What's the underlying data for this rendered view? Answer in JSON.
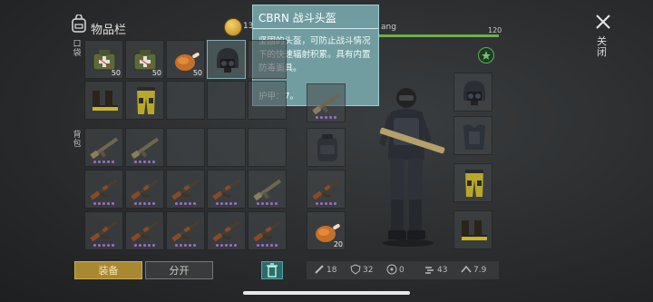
{
  "header": {
    "title": "物品栏",
    "coins": "13",
    "close_label": "关闭"
  },
  "side_labels": {
    "pockets": "口袋",
    "backpack": "背包"
  },
  "tooltip": {
    "title": "CBRN 战斗头盔",
    "description": "坚固的头盔，可防止战斗情况下的快速辐射积累。具有内置防毒面具。",
    "armor": "护甲：7。"
  },
  "character": {
    "name_fragment": "ang",
    "hp": "120",
    "hp_fraction": 1.0
  },
  "pocket_items": [
    {
      "icon": "medkit-icon",
      "count": "50"
    },
    {
      "icon": "medkit-icon",
      "count": "50"
    },
    {
      "icon": "roast-chicken-icon",
      "count": "50"
    },
    {
      "icon": "cbrn-helmet-icon",
      "count": ""
    },
    {
      "icon": "boots-icon",
      "count": ""
    },
    {
      "icon": "pants-icon",
      "count": ""
    }
  ],
  "backpack_items": [
    {
      "icon": "rifle-icon",
      "count": ""
    },
    {
      "icon": "rifle-icon",
      "count": ""
    },
    {
      "icon": "ak-rifle-icon",
      "count": ""
    },
    {
      "icon": "ak-rifle-icon",
      "count": ""
    },
    {
      "icon": "ak-rifle-icon",
      "count": ""
    },
    {
      "icon": "ak-rifle-icon",
      "count": ""
    },
    {
      "icon": "rifle-icon",
      "count": ""
    },
    {
      "icon": "ak-rifle-icon",
      "count": ""
    },
    {
      "icon": "ak-rifle-icon",
      "count": ""
    },
    {
      "icon": "ak-rifle-icon",
      "count": ""
    },
    {
      "icon": "ak-rifle-icon",
      "count": ""
    },
    {
      "icon": "ak-rifle-icon",
      "count": ""
    }
  ],
  "equipped_left": [
    {
      "icon": "rifle-icon",
      "count": ""
    },
    {
      "icon": "backpack-icon",
      "count": ""
    },
    {
      "icon": "ak-rifle-icon",
      "count": ""
    },
    {
      "icon": "roast-chicken-icon",
      "count": "20"
    }
  ],
  "equipped_right": [
    {
      "icon": "cbrn-helmet-icon"
    },
    {
      "icon": "armor-vest-icon"
    },
    {
      "icon": "pants-icon"
    },
    {
      "icon": "boots-icon"
    }
  ],
  "buttons": {
    "equip": "装备",
    "split": "分开"
  },
  "stats": [
    {
      "icon": "attack-icon",
      "value": "18"
    },
    {
      "icon": "defense-icon",
      "value": "32"
    },
    {
      "icon": "radiation-icon",
      "value": "0"
    },
    {
      "icon": "speed-icon",
      "value": "43"
    },
    {
      "icon": "stealth-icon",
      "value": "7.9"
    }
  ]
}
